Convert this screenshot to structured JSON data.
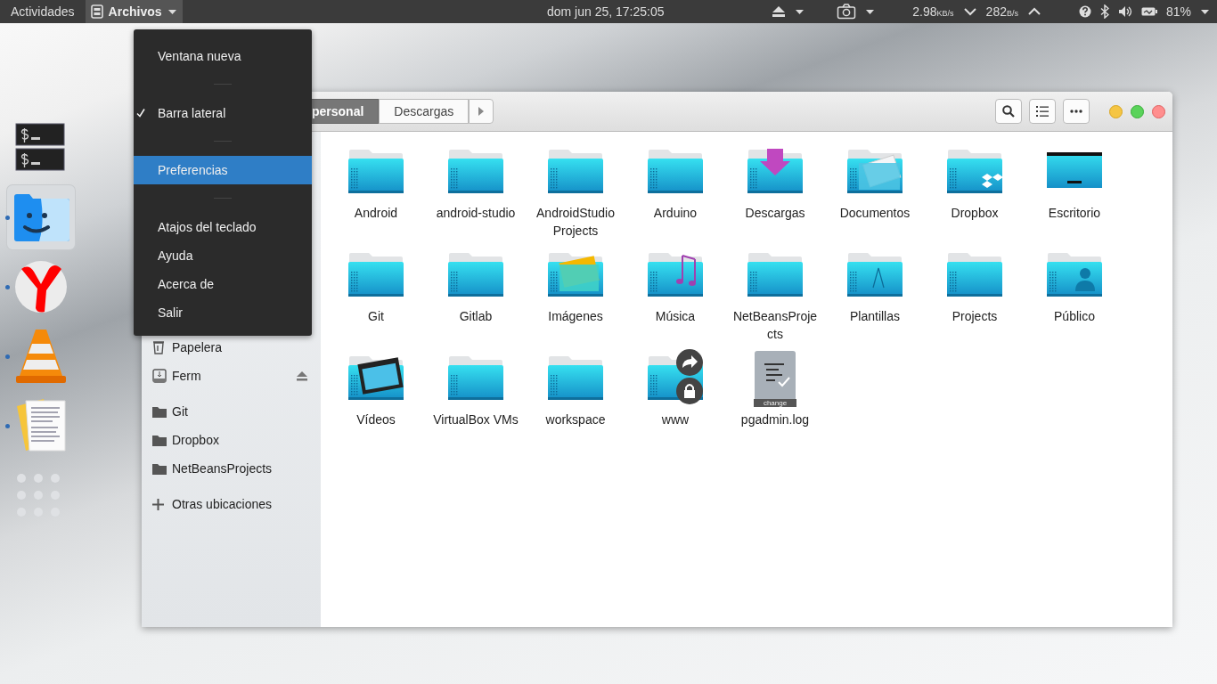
{
  "top_bar": {
    "activities": "Actividades",
    "app_menu": {
      "label": "Archivos",
      "expanded": true
    },
    "clock": "dom jun 25, 17:25:05",
    "net_down": {
      "value": "2.98",
      "unit": "KB/s"
    },
    "net_up": {
      "value": "282",
      "unit": "B/s"
    },
    "battery": "81%"
  },
  "dock": [
    {
      "kind": "terminal",
      "running": false,
      "focused": false
    },
    {
      "kind": "files",
      "running": true,
      "focused": true
    },
    {
      "kind": "browser",
      "running": true,
      "focused": false
    },
    {
      "kind": "vlc",
      "running": true,
      "focused": false
    },
    {
      "kind": "editor",
      "running": true,
      "focused": false
    },
    {
      "kind": "apps",
      "running": false,
      "focused": false
    }
  ],
  "app_menu_items": [
    {
      "kind": "item",
      "label": "Ventana nueva",
      "checked": false,
      "selected": false
    },
    {
      "kind": "separator"
    },
    {
      "kind": "item",
      "label": "Barra lateral",
      "checked": true,
      "selected": false
    },
    {
      "kind": "separator"
    },
    {
      "kind": "item",
      "label": "Preferencias",
      "checked": false,
      "selected": true
    },
    {
      "kind": "separator"
    },
    {
      "kind": "item",
      "label": "Atajos del teclado",
      "checked": false,
      "selected": false
    },
    {
      "kind": "item",
      "label": "Ayuda",
      "checked": false,
      "selected": false
    },
    {
      "kind": "item",
      "label": "Acerca de",
      "checked": false,
      "selected": false
    },
    {
      "kind": "item",
      "label": "Salir",
      "checked": false,
      "selected": false
    }
  ],
  "window": {
    "pathbar": [
      {
        "label": "personal",
        "selected": true
      },
      {
        "label": "Descargas",
        "selected": false
      }
    ],
    "sidebar": [
      {
        "kind": "trash",
        "label": "Papelera",
        "ejectable": false
      },
      {
        "kind": "drive",
        "label": "Ferm",
        "ejectable": true
      },
      {
        "kind": "bookmark",
        "label": "Git",
        "ejectable": false
      },
      {
        "kind": "bookmark",
        "label": "Dropbox",
        "ejectable": false
      },
      {
        "kind": "bookmark",
        "label": "NetBeansProjects",
        "ejectable": false
      },
      {
        "kind": "other",
        "label": "Otras ubicaciones",
        "ejectable": false
      }
    ],
    "files": [
      {
        "kind": "folder",
        "name": "Android"
      },
      {
        "kind": "folder",
        "name": "android-studio"
      },
      {
        "kind": "folder",
        "name": "AndroidStudio Projects"
      },
      {
        "kind": "folder",
        "name": "Arduino"
      },
      {
        "kind": "downloads",
        "name": "Descargas"
      },
      {
        "kind": "documents",
        "name": "Documentos"
      },
      {
        "kind": "dropbox",
        "name": "Dropbox"
      },
      {
        "kind": "desktop",
        "name": "Escritorio"
      },
      {
        "kind": "folder",
        "name": "Git"
      },
      {
        "kind": "folder",
        "name": "Gitlab"
      },
      {
        "kind": "pictures",
        "name": "Imágenes"
      },
      {
        "kind": "music",
        "name": "Música"
      },
      {
        "kind": "folder",
        "name": "NetBeansProjects"
      },
      {
        "kind": "templates",
        "name": "Plantillas"
      },
      {
        "kind": "folder",
        "name": "Projects"
      },
      {
        "kind": "public",
        "name": "Público"
      },
      {
        "kind": "videos",
        "name": "Vídeos"
      },
      {
        "kind": "folder",
        "name": "VirtualBox VMs"
      },
      {
        "kind": "folder",
        "name": "workspace"
      },
      {
        "kind": "locked_link",
        "name": "www"
      },
      {
        "kind": "file",
        "name": "pgadmin.log",
        "badge": "change"
      }
    ]
  }
}
